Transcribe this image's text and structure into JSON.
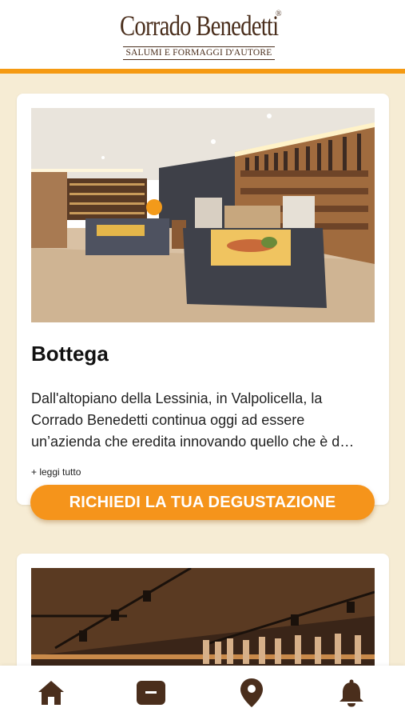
{
  "header": {
    "logo_name": "Corrado Benedetti",
    "logo_registered": "®",
    "logo_tagline": "SALUMI E FORMAGGI D'AUTORE"
  },
  "cards": [
    {
      "title": "Bottega",
      "description": "Dall'altopiano della Lessinia, in Valpolicella, la Corrado Benedetti continua oggi ad essere un’azienda che eredita innovando quello che è d…",
      "read_more": "+ leggi tutto",
      "cta_label": "RICHIEDI LA TUA DEGUSTAZIONE"
    }
  ],
  "bottom_nav": {
    "items": [
      {
        "icon": "home-icon"
      },
      {
        "icon": "card-icon"
      },
      {
        "icon": "map-pin-icon"
      },
      {
        "icon": "bell-icon"
      }
    ]
  },
  "colors": {
    "accent": "#f5941b",
    "brand_brown": "#4a2e1c",
    "background": "#f6ecd4"
  }
}
